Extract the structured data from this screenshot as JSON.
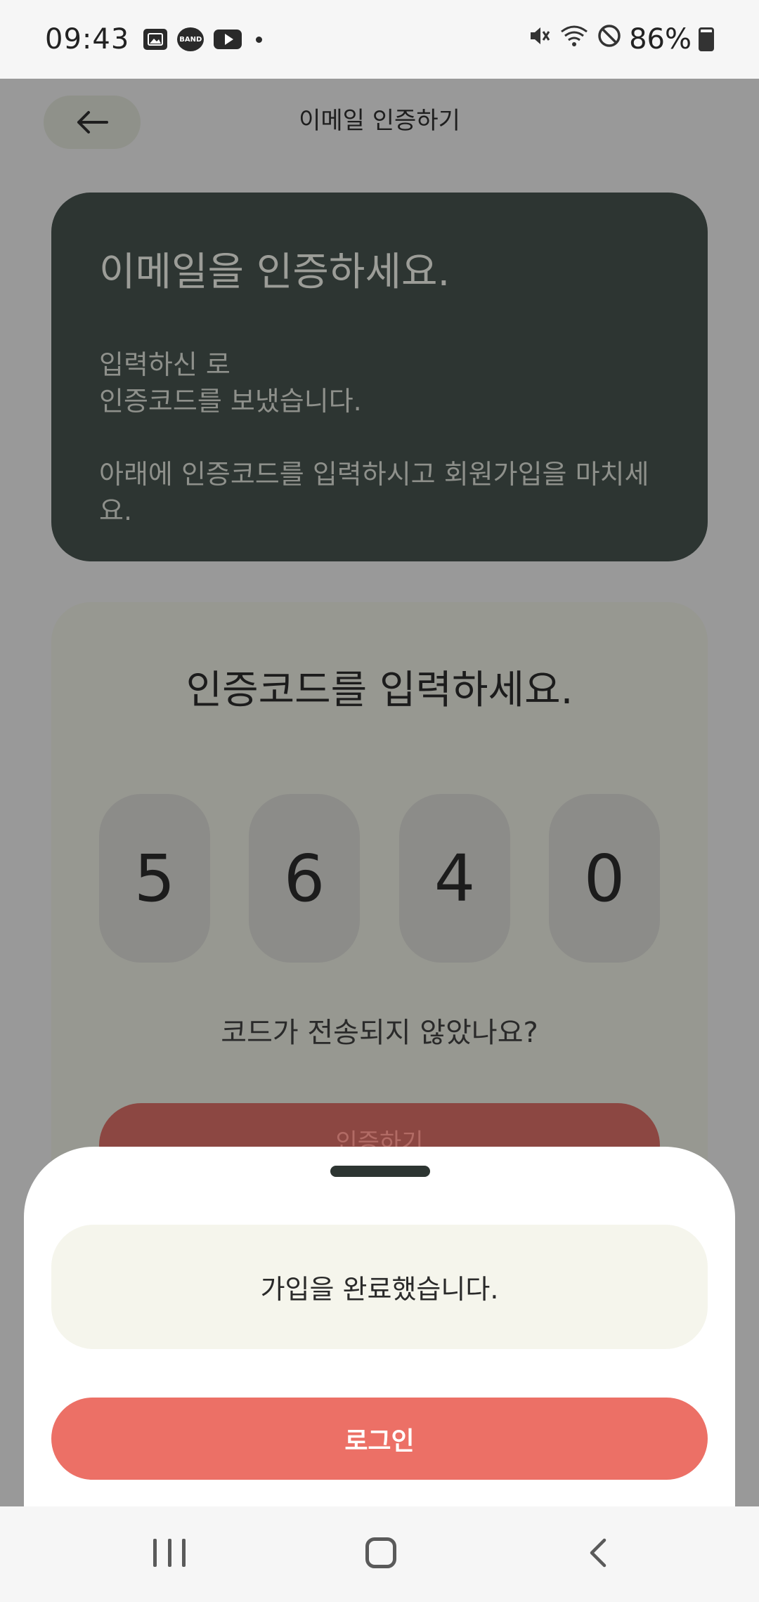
{
  "status_bar": {
    "time": "09:43",
    "notification_icons": [
      "gallery-icon",
      "band-icon",
      "youtube-icon",
      "more-dot-icon"
    ],
    "band_label": "BAND",
    "system_icons": [
      "mute-icon",
      "wifi-icon",
      "do-not-disturb-icon",
      "battery-charging-icon"
    ],
    "battery_percent": "86%"
  },
  "header": {
    "title": "이메일 인증하기"
  },
  "info_card": {
    "title": "이메일을 인증하세요.",
    "line1": "입력하신 로",
    "line2": "인증코드를 보냈습니다.",
    "line3": "아래에 인증코드를 입력하시고 회원가입을 마치세요."
  },
  "code_card": {
    "title": "인증코드를 입력하세요.",
    "digits": [
      "5",
      "6",
      "4",
      "0"
    ],
    "resend_label": "코드가 전송되지 않았나요?",
    "verify_label": "인증하기"
  },
  "bottom_sheet": {
    "message": "가입을 완료했습니다.",
    "login_label": "로그인"
  },
  "colors": {
    "accent": "#ec7066",
    "dark_card": "#2d3532",
    "message_bg": "#f5f5ec"
  }
}
